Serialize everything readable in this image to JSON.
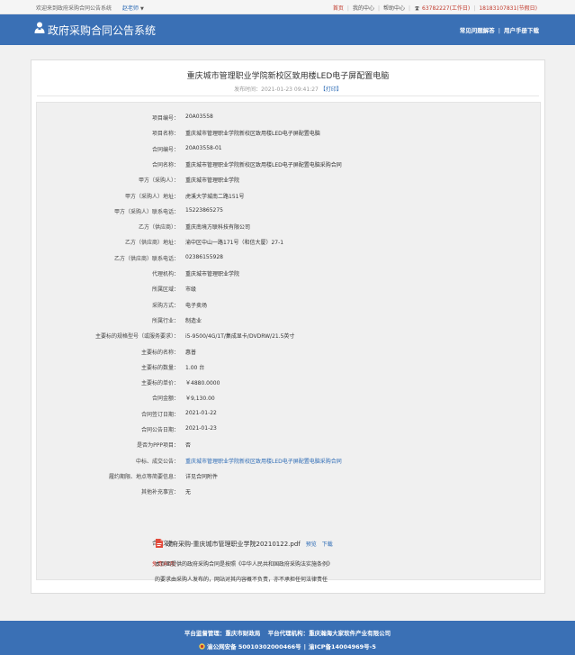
{
  "topbar": {
    "welcome": "欢迎来到政府采购合同公告系统",
    "user": "赵老师",
    "links": [
      "首页",
      "我的中心",
      "帮助中心"
    ],
    "phone_icon": "phone-icon",
    "phone1": "63782227(工作日)",
    "phone2": "18183107831(节假日)"
  },
  "header": {
    "title": "政府采购合同公告系统",
    "nav": [
      "常见问题解答",
      "用户手册下载"
    ]
  },
  "doc": {
    "title": "重庆城市管理职业学院新校区致用楼LED电子屏配置电脑",
    "publish_label": "发布时间：",
    "publish_time": "2021-01-23 09:41:27",
    "print_label": "【打印】"
  },
  "fields": [
    {
      "label": "项目编号：",
      "value": "20A03558"
    },
    {
      "label": "项目名称：",
      "value": "重庆城市管理职业学院新校区致用楼LED电子屏配置电脑"
    },
    {
      "label": "合同编号：",
      "value": "20A03558-01"
    },
    {
      "label": "合同名称：",
      "value": "重庆城市管理职业学院新校区致用楼LED电子屏配置电脑采购合同"
    },
    {
      "label": "甲方（采购人）：",
      "value": "重庆城市管理职业学院"
    },
    {
      "label": "甲方（采购人）地址：",
      "value": "虎溪大学城南二路151号"
    },
    {
      "label": "甲方（采购人）联系电话：",
      "value": "15223865275"
    },
    {
      "label": "乙方（供应商）：",
      "value": "重庆南境方联科技有限公司"
    },
    {
      "label": "乙方（供应商）地址：",
      "value": "渝中区中山一路171号（和信大厦）27-1"
    },
    {
      "label": "乙方（供应商）联系电话：",
      "value": "02386155928"
    },
    {
      "label": "代理机构：",
      "value": "重庆城市管理职业学院"
    },
    {
      "label": "所属区域：",
      "value": "市级"
    },
    {
      "label": "采购方式：",
      "value": "电子卖场"
    },
    {
      "label": "所属行业：",
      "value": "制造业"
    },
    {
      "label": "主要标的规格型号（或服务要求）：",
      "value": "i5-9500/4G/1T/集成显卡/DVDRW/21.5英寸"
    },
    {
      "label": "主要标的名称：",
      "value": "惠普"
    },
    {
      "label": "主要标的数量：",
      "value": "1.00 台"
    },
    {
      "label": "主要标的单价：",
      "value": "￥4880.0000"
    },
    {
      "label": "合同金额：",
      "value": "￥9,130.00"
    },
    {
      "label": "合同签订日期：",
      "value": "2021-01-22"
    },
    {
      "label": "合同公告日期：",
      "value": "2021-01-23"
    },
    {
      "label": "是否为PPP项目：",
      "value": "否"
    },
    {
      "label": "中标、成交公告：",
      "value": "重庆城市管理职业学院新校区致用楼LED电子屏配置电脑采购合同"
    },
    {
      "label": "履约期限、地点等简要信息：",
      "value": "详见合同附件"
    },
    {
      "label": "其他补充事宜：",
      "value": "无"
    }
  ],
  "attachment": {
    "label": "合同文件：",
    "filename": "政府采购-重庆城市管理职业学院20210122.pdf",
    "preview": "预览",
    "download": "下载"
  },
  "disclaimer": {
    "label": "免责声明：",
    "line1": "本页面提供的政府采购合同是按照《中华人民共和国政府采购法实施条例》",
    "line2": "的要求由采购人发布的，网站对其内容概不负责，亦不承担任何法律责任"
  },
  "footer": {
    "supervisor": "平台监督管理：重庆市财政局",
    "operator": "平台代理机构：重庆瀚海大家软件产业有限公司",
    "police": "渝公网安备 50010302000466号",
    "icp": "渝ICP备14004969号-5"
  },
  "colors": {
    "brand": "#3a70b5",
    "link": "#2d6bb5",
    "alert": "#d0342c"
  }
}
